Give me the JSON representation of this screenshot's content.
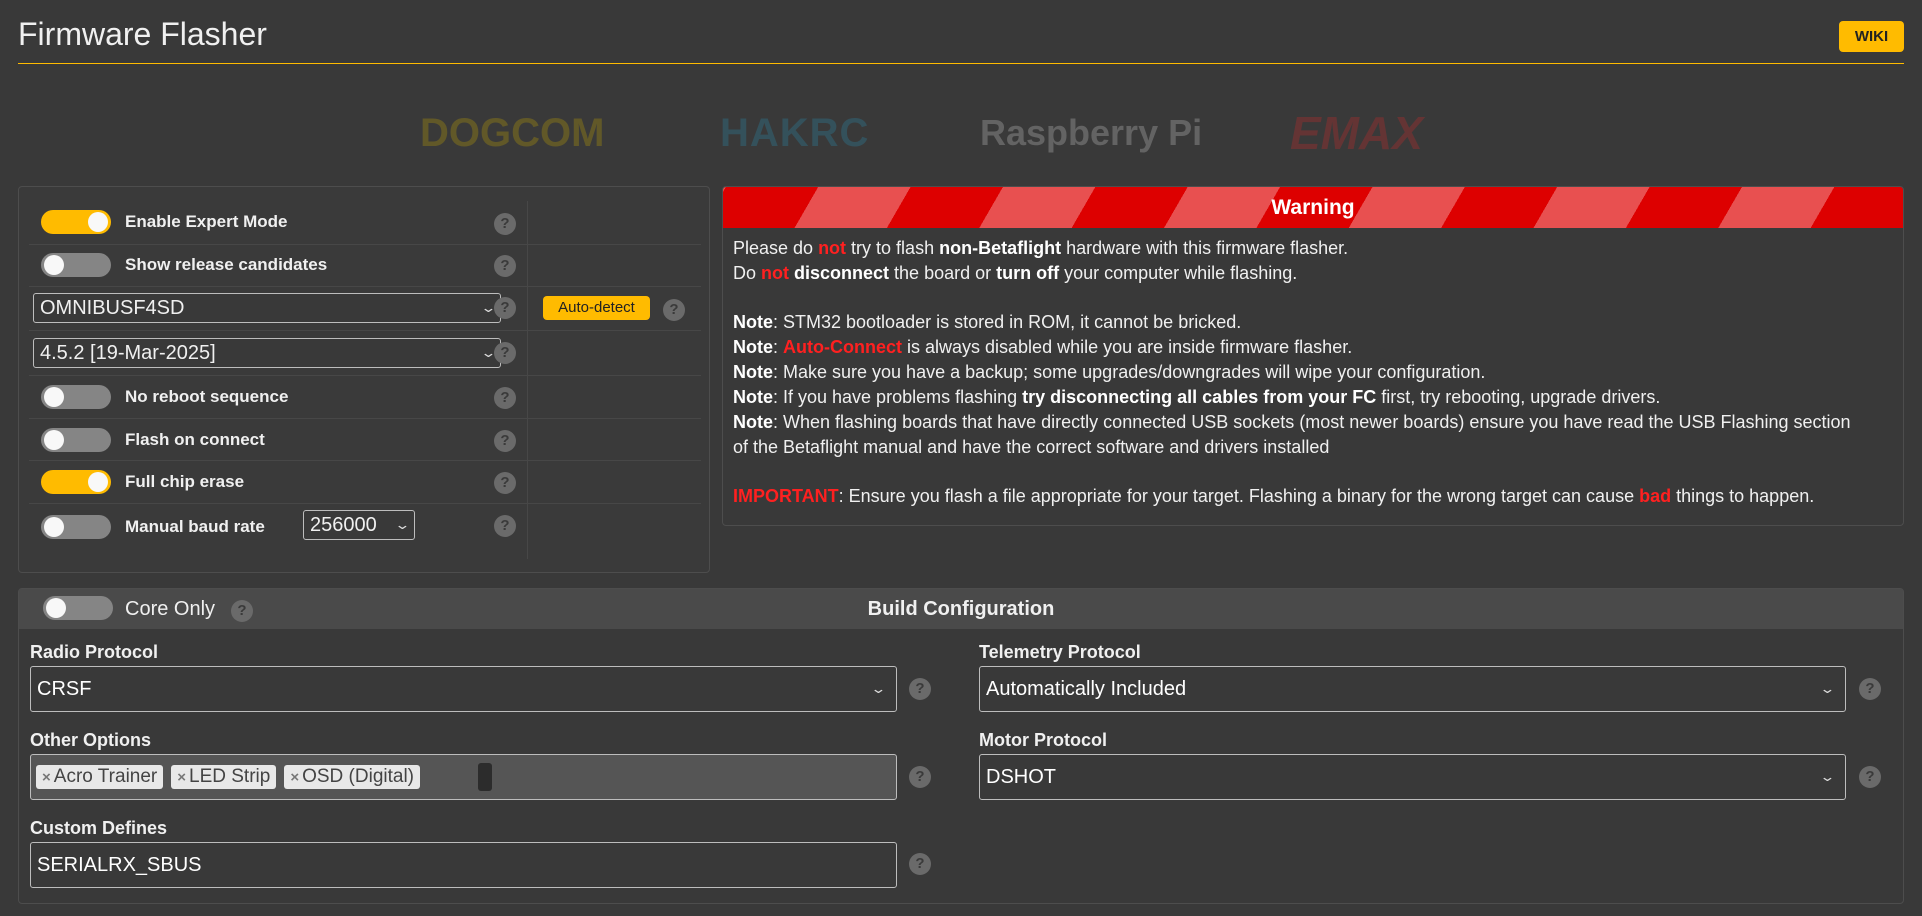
{
  "header": {
    "title": "Firmware Flasher",
    "wiki_label": "WIKI"
  },
  "sponsors": [
    "DOGCOM",
    "HAKRC",
    "Raspberry Pi",
    "EMAX"
  ],
  "options": {
    "expert_mode": {
      "label": "Enable Expert Mode",
      "on": true
    },
    "release_candidates": {
      "label": "Show release candidates",
      "on": false
    },
    "board_select": {
      "value": "OMNIBUSF4SD"
    },
    "auto_detect_label": "Auto-detect",
    "version_select": {
      "value": "4.5.2 [19-Mar-2025]"
    },
    "no_reboot": {
      "label": "No reboot sequence",
      "on": false
    },
    "flash_on_connect": {
      "label": "Flash on connect",
      "on": false
    },
    "full_chip_erase": {
      "label": "Full chip erase",
      "on": true
    },
    "manual_baud": {
      "label": "Manual baud rate",
      "on": false,
      "baud_value": "256000"
    },
    "help_glyph": "?"
  },
  "warning": {
    "title": "Warning",
    "line1": {
      "a": "Please do ",
      "not": "not",
      "b": " try to flash ",
      "bold": "non-Betaflight",
      "c": " hardware with this firmware flasher."
    },
    "line2": {
      "a": "Do ",
      "not": "not",
      "b": " ",
      "bold1": "disconnect",
      "c": " the board or ",
      "bold2": "turn off",
      "d": " your computer while flashing."
    },
    "note_label": "Note",
    "note1": ": STM32 bootloader is stored in ROM, it cannot be bricked.",
    "note2": {
      "a": ": ",
      "red": "Auto-Connect",
      "b": " is always disabled while you are inside firmware flasher."
    },
    "note3": ": Make sure you have a backup; some upgrades/downgrades will wipe your configuration.",
    "note4": {
      "a": ": If you have problems flashing ",
      "bold": "try disconnecting all cables from your FC",
      "b": " first, try rebooting, upgrade drivers."
    },
    "note5a": ": When flashing boards that have directly connected USB sockets (most newer boards) ensure you have read the USB Flashing section",
    "note5b": "of the Betaflight manual and have the correct software and drivers installed",
    "important": {
      "label": "IMPORTANT",
      "a": ": Ensure you flash a file appropriate for your target. Flashing a binary for the wrong target can cause ",
      "bad": "bad",
      "b": " things to happen."
    }
  },
  "build": {
    "title": "Build Configuration",
    "core_only": {
      "label": "Core Only",
      "on": false
    },
    "radio_protocol": {
      "label": "Radio Protocol",
      "value": "CRSF"
    },
    "telemetry_protocol": {
      "label": "Telemetry Protocol",
      "value": "Automatically Included"
    },
    "other_options": {
      "label": "Other Options",
      "chips": [
        "Acro Trainer",
        "LED Strip",
        "OSD (Digital)"
      ]
    },
    "motor_protocol": {
      "label": "Motor Protocol",
      "value": "DSHOT"
    },
    "custom_defines": {
      "label": "Custom Defines",
      "value": "SERIALRX_SBUS"
    }
  },
  "colors": {
    "accent": "#ffbb00",
    "warning_red": "#dd0000",
    "background": "#393939"
  }
}
